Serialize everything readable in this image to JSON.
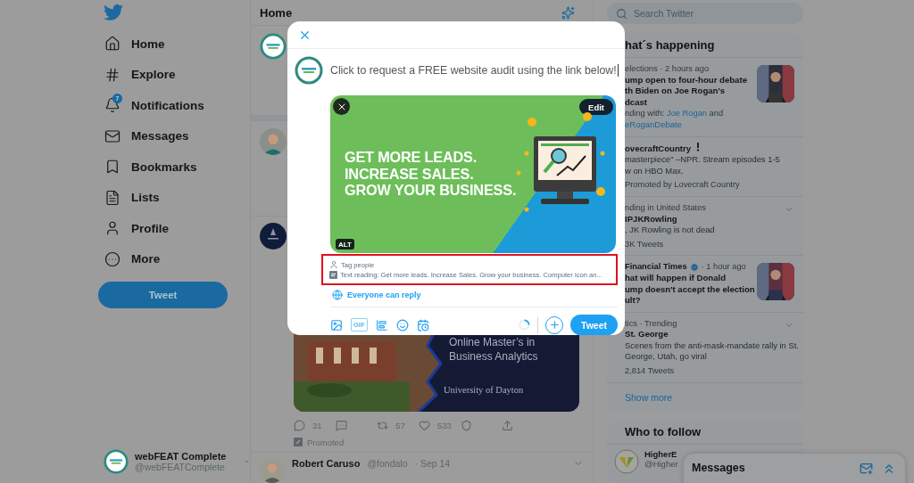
{
  "sidebar": {
    "items": [
      {
        "label": "Home"
      },
      {
        "label": "Explore"
      },
      {
        "label": "Notifications",
        "badge": "7"
      },
      {
        "label": "Messages"
      },
      {
        "label": "Bookmarks"
      },
      {
        "label": "Lists"
      },
      {
        "label": "Profile"
      },
      {
        "label": "More"
      }
    ],
    "tweet_button": "Tweet",
    "account": {
      "name": "webFEAT Complete",
      "handle": "@webFEATComplete"
    }
  },
  "feed": {
    "title": "Home",
    "promo": {
      "headline": "Online Master’s in Business Analytics",
      "brand": "University of Dayton"
    },
    "reply_count": "31",
    "retweet_count": "57",
    "like_count": "533",
    "promoted": "Promoted",
    "next_tweet": {
      "name": "Robert Caruso",
      "handle": "@fondalo",
      "time": "· Sep 14"
    }
  },
  "composer": {
    "text": "Click to request a FREE website audit using the link below!",
    "image": {
      "headline": [
        "GET MORE LEADS.",
        "INCREASE SALES.",
        "GROW YOUR BUSINESS."
      ],
      "edit": "Edit",
      "alt": "ALT"
    },
    "tag_people": "Tag people",
    "description": "Text reading: Get more leads. Increase Sales. Grow your business. Computer icon an...",
    "reply_setting": "Everyone can reply",
    "gif_label": "GIF",
    "tweet_button": "Tweet"
  },
  "search": {
    "placeholder": "Search Twitter"
  },
  "trends": {
    "title": "hat´s happening",
    "items": [
      {
        "kind": "news",
        "context": "elections · 2 hours ago",
        "title_lines": [
          "ump open to four-hour debate",
          "th Biden on Joe Rogan's",
          "dcast"
        ],
        "with_label": "nding with:",
        "links": [
          "Joe Rogan",
          "eRoganDebate"
        ],
        "joiner": "and"
      },
      {
        "kind": "promoted",
        "title_lines": [
          "ovecraftCountry"
        ],
        "desc_lines": [
          "masterpiece\" –NPR. Stream episodes 1-5",
          "w on HBO Max."
        ],
        "footer": "Promoted by Lovecraft Country"
      },
      {
        "kind": "trend",
        "context": "nding in United States",
        "title_lines": [
          "IPJKRowling"
        ],
        "desc_lines": [
          ", JK Rowling is not dead"
        ],
        "footer": "3K Tweets"
      },
      {
        "kind": "news",
        "source": "Financial Times",
        "context": "· 1 hour ago",
        "title_lines": [
          "hat will happen if Donald",
          "ump doesn't accept the election",
          "ult?"
        ]
      },
      {
        "kind": "trend",
        "context": "tics · Trending",
        "title_lines": [
          "St. George"
        ],
        "desc_lines": [
          "Scenes from the anti-mask-mandate rally in St.",
          "George, Utah, go viral"
        ],
        "footer": "2,814 Tweets"
      }
    ],
    "show_more": "Show more"
  },
  "who_to_follow": {
    "title": "Who to follow",
    "name": "HigherE",
    "handle": "@Higher"
  },
  "messages_drawer": {
    "title": "Messages"
  }
}
